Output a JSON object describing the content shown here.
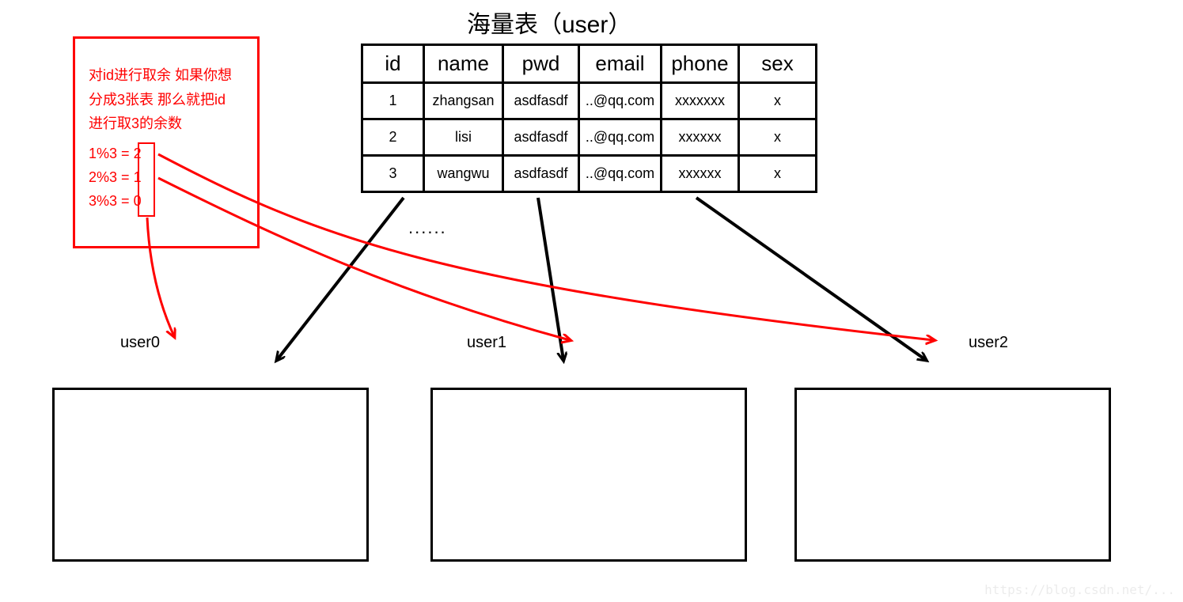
{
  "title": "海量表（user）",
  "table": {
    "headers": [
      "id",
      "name",
      "pwd",
      "email",
      "phone",
      "sex"
    ],
    "rows": [
      {
        "id": "1",
        "name": "zhangsan",
        "pwd": "asdfasdf",
        "email": "..@qq.com",
        "phone": "xxxxxxx",
        "sex": "x"
      },
      {
        "id": "2",
        "name": "lisi",
        "pwd": "asdfasdf",
        "email": "..@qq.com",
        "phone": "xxxxxx",
        "sex": "x"
      },
      {
        "id": "3",
        "name": "wangwu",
        "pwd": "asdfasdf",
        "email": "..@qq.com",
        "phone": "xxxxxx",
        "sex": "x"
      }
    ],
    "ellipsis": "......"
  },
  "note": {
    "line1": "对id进行取余 如果你想",
    "line2": "分成3张表 那么就把id",
    "line3": "进行取3的余数",
    "calc": [
      {
        "expr": "1%3 =",
        "result": "2"
      },
      {
        "expr": "2%3 =",
        "result": "1"
      },
      {
        "expr": "3%3 =",
        "result": "0"
      }
    ]
  },
  "subtables": {
    "labels": [
      "user0",
      "user1",
      "user2"
    ]
  },
  "watermark": "https://blog.csdn.net/..."
}
